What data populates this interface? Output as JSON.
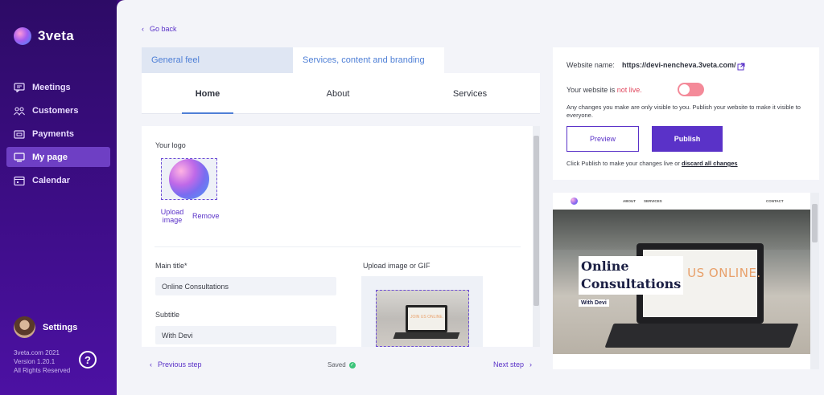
{
  "sidebar": {
    "brand": "3veta",
    "items": [
      {
        "label": "Meetings",
        "icon": "meetings-icon"
      },
      {
        "label": "Customers",
        "icon": "customers-icon"
      },
      {
        "label": "Payments",
        "icon": "payments-icon"
      },
      {
        "label": "My page",
        "icon": "my-page-icon",
        "active": true
      },
      {
        "label": "Calendar",
        "icon": "calendar-icon"
      }
    ],
    "settings_label": "Settings",
    "footer_line1": "3veta.com 2021",
    "footer_line2": "Version 1.20.1",
    "footer_line3": "All Rights Reserved",
    "help_glyph": "?"
  },
  "header": {
    "go_back": "Go back",
    "tabs": [
      {
        "label": "General feel"
      },
      {
        "label": "Services, content and branding",
        "active": true
      }
    ]
  },
  "subnav": {
    "items": [
      {
        "label": "Home",
        "active": true
      },
      {
        "label": "About"
      },
      {
        "label": "Services"
      }
    ]
  },
  "form": {
    "logo_label": "Your logo",
    "upload_image": "Upload image",
    "remove": "Remove",
    "main_title_label": "Main title*",
    "main_title_value": "Online Consultations",
    "subtitle_label": "Subtitle",
    "subtitle_value": "With Devi",
    "gif_label": "Upload image or GIF",
    "gif_screen_text": "JOIN US ONLINE."
  },
  "footer_bar": {
    "previous": "Previous step",
    "saved": "Saved",
    "next": "Next step"
  },
  "publish": {
    "website_name_label": "Website name:",
    "website_url": "https://devi-nencheva.3veta.com/",
    "live_prefix": "Your website is ",
    "live_status": "not live.",
    "note": "Any changes you make are only visible to you. Publish your website to make it visible to everyone.",
    "preview_button": "Preview",
    "publish_button": "Publish",
    "hint_prefix": "Click Publish to make your changes live or ",
    "discard_link": "discard all changes",
    "toggle_on": false
  },
  "preview": {
    "nav_about": "ABOUT",
    "nav_services": "SERVICES",
    "nav_contact": "CONTACT",
    "title_line1": "Online",
    "title_line2": "Consultations",
    "subtitle": "With Devi",
    "screen_text": "JOIN US ONLINE."
  },
  "colors": {
    "accent": "#5a32c8",
    "tab_blue": "#4e7fd6",
    "status_red": "#e0465d",
    "saved_green": "#3cc47a"
  }
}
